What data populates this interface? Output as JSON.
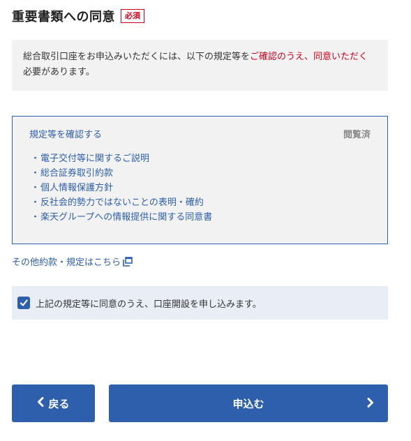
{
  "section": {
    "title": "重要書類への同意",
    "required_badge": "必須"
  },
  "notice": {
    "text_before": "総合取引口座をお申込みいただくには、以下の規定等を",
    "text_emphasis": "ご確認のうえ、同意いただく",
    "text_after": "必要があります。"
  },
  "terms": {
    "link_label": "規定等を確認する",
    "status": "閲覧済",
    "items": [
      "電子交付等に関するご説明",
      "総合証券取引約款",
      "個人情報保護方針",
      "反社会的勢力ではないことの表明・確約",
      "楽天グループへの情報提供に関する同意書"
    ],
    "bullet": "・"
  },
  "other_terms_link": "その他約款・規定はこちら",
  "agreement": {
    "checked": true,
    "label": "上記の規定等に同意のうえ、口座開設を申し込みます。"
  },
  "buttons": {
    "back_label": "戻る",
    "submit_label": "申込む"
  },
  "colors": {
    "accent": "#2d5fad",
    "required": "#d0021b",
    "panel_bg": "#f2f2f2",
    "agree_bg": "#e9edf5"
  }
}
